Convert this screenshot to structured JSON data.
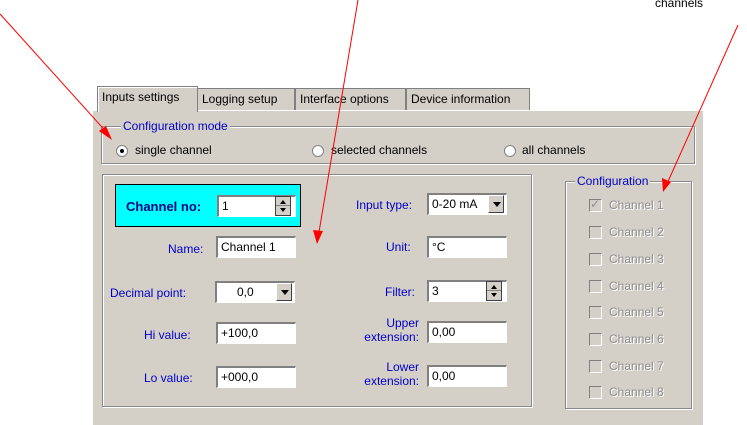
{
  "caption": "channels",
  "tabs": [
    {
      "label": "Inputs settings",
      "active": true
    },
    {
      "label": "Logging setup",
      "active": false
    },
    {
      "label": "Interface options",
      "active": false
    },
    {
      "label": "Device information",
      "active": false
    }
  ],
  "config_mode": {
    "title": "Configuration mode",
    "options": [
      {
        "label": "single channel",
        "selected": true
      },
      {
        "label": "selected channels",
        "selected": false
      },
      {
        "label": "all channels",
        "selected": false
      }
    ]
  },
  "form": {
    "channel_no_label": "Channel no:",
    "channel_no_value": "1",
    "name_label": "Name:",
    "name_value": "Channel 1",
    "decimal_label": "Decimal point:",
    "decimal_value": "0,0",
    "hi_label": "Hi value:",
    "hi_value": "+100,0",
    "lo_label": "Lo value:",
    "lo_value": "+000,0",
    "input_type_label": "Input type:",
    "input_type_value": "0-20 mA",
    "unit_label": "Unit:",
    "unit_value": "°C",
    "filter_label": "Filter:",
    "filter_value": "3",
    "upper_ext_label_1": "Upper",
    "upper_ext_label_2": "extension:",
    "upper_ext_value": "0,00",
    "lower_ext_label_1": "Lower",
    "lower_ext_label_2": "extension:",
    "lower_ext_value": "0,00"
  },
  "configuration": {
    "title": "Configuration",
    "channels": [
      {
        "label": "Channel 1",
        "checked": true
      },
      {
        "label": "Channel 2",
        "checked": false
      },
      {
        "label": "Channel 3",
        "checked": false
      },
      {
        "label": "Channel 4",
        "checked": false
      },
      {
        "label": "Channel 5",
        "checked": false
      },
      {
        "label": "Channel 6",
        "checked": false
      },
      {
        "label": "Channel 7",
        "checked": false
      },
      {
        "label": "Channel 8",
        "checked": false
      }
    ]
  },
  "colors": {
    "dialog_bg": "#d4d0c8",
    "highlight": "#00ffff",
    "label_blue": "#0000c8",
    "arrow_red": "#ff0000"
  }
}
